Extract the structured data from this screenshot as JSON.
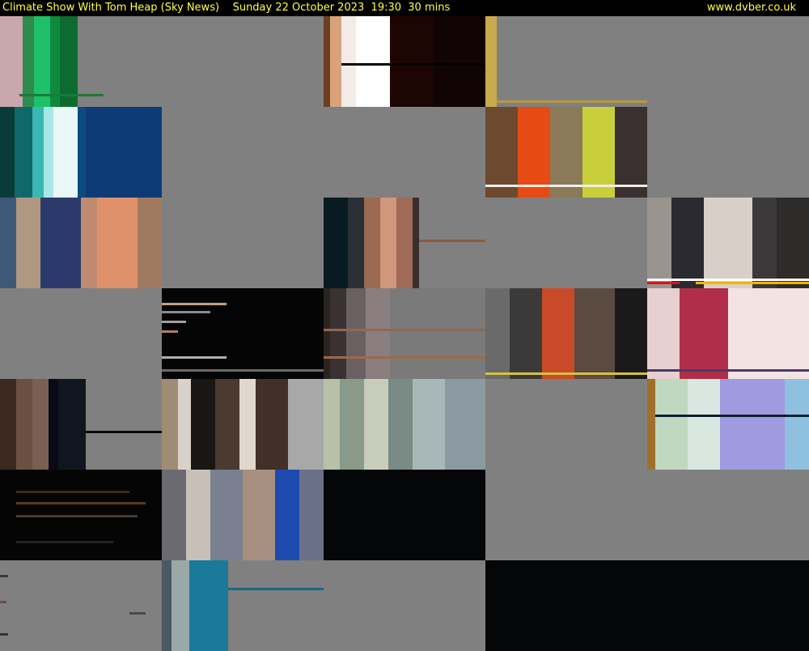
{
  "header": {
    "program_title": "Climate Show With Tom Heap (Sky News)",
    "date": "Sunday 22 October 2023",
    "time": "19:30",
    "duration": "30 mins",
    "site": "www.dvber.co.uk"
  },
  "grid": {
    "rows": 7,
    "cols": 5,
    "frames": [
      {
        "style": "green-stripes"
      },
      {
        "style": "grey"
      },
      {
        "style": "warm-stripes"
      },
      {
        "style": "gold-frame"
      },
      {
        "style": "grey"
      },
      {
        "style": "teal-blue"
      },
      {
        "style": "grey"
      },
      {
        "style": "grey"
      },
      {
        "style": "workers"
      },
      {
        "style": "grey"
      },
      {
        "style": "sofa-women"
      },
      {
        "style": "grey"
      },
      {
        "style": "copper-stripes"
      },
      {
        "style": "grey"
      },
      {
        "style": "street-news"
      },
      {
        "style": "grey"
      },
      {
        "style": "dark-lines"
      },
      {
        "style": "brown-stripes"
      },
      {
        "style": "glitch-red"
      },
      {
        "style": "woman-news"
      },
      {
        "style": "brown-dark"
      },
      {
        "style": "cream-stripes"
      },
      {
        "style": "sage-stripes"
      },
      {
        "style": "grey"
      },
      {
        "style": "sky-blue"
      },
      {
        "style": "black-glitch"
      },
      {
        "style": "blue-blur"
      },
      {
        "style": "black"
      },
      {
        "style": "grey"
      },
      {
        "style": "grey"
      },
      {
        "style": "grey-noise"
      },
      {
        "style": "teal-stripe"
      },
      {
        "style": "grey"
      },
      {
        "style": "black"
      },
      {
        "style": "black"
      }
    ]
  }
}
